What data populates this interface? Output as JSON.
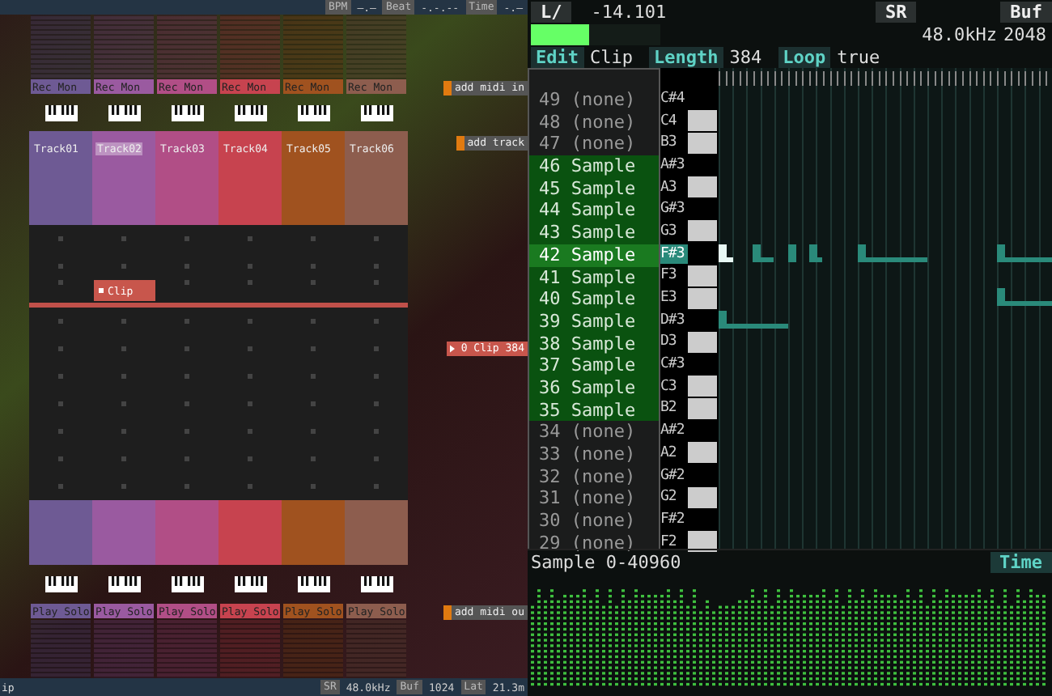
{
  "transport": [
    {
      "label": "BPM",
      "value": "—.—"
    },
    {
      "label": "Beat",
      "value": "-.-.--"
    },
    {
      "label": "Time",
      "value": "-.—"
    }
  ],
  "tracks": [
    {
      "name": "Track01",
      "color": "#6e5a94",
      "selected": false,
      "input": [
        "Rec",
        "Mon"
      ],
      "output": [
        "Play",
        "Solo"
      ]
    },
    {
      "name": "Track02",
      "color": "#9a5aa0",
      "selected": true,
      "input": [
        "Rec",
        "Mon"
      ],
      "output": [
        "Play",
        "Solo"
      ]
    },
    {
      "name": "Track03",
      "color": "#b14e86",
      "selected": false,
      "input": [
        "Rec",
        "Mon"
      ],
      "output": [
        "Play",
        "Solo"
      ]
    },
    {
      "name": "Track04",
      "color": "#c7434f",
      "selected": false,
      "input": [
        "Rec",
        "Mon"
      ],
      "output": [
        "Play",
        "Solo"
      ]
    },
    {
      "name": "Track05",
      "color": "#a0521f",
      "selected": false,
      "input": [
        "Rec",
        "Mon"
      ],
      "output": [
        "Play",
        "Solo"
      ]
    },
    {
      "name": "Track06",
      "color": "#8d5d4e",
      "selected": false,
      "input": [
        "Rec",
        "Mon"
      ],
      "output": [
        "Play",
        "Solo"
      ]
    }
  ],
  "add_midi_in": "add midi in",
  "add_track": "add track",
  "add_midi_out": "add midi ou",
  "scenes": [
    {
      "active": false
    },
    {
      "active": false
    },
    {
      "active": true,
      "slots": [
        {
          "kind": "empty"
        },
        {
          "kind": "clip",
          "label": "Clip",
          "color": "#c8564c"
        },
        {
          "kind": "empty"
        },
        {
          "kind": "empty"
        },
        {
          "kind": "empty"
        },
        {
          "kind": "empty"
        }
      ]
    },
    {
      "active": false
    },
    {
      "active": false,
      "launcher": "0 Clip 384"
    },
    {
      "active": false
    },
    {
      "active": false
    },
    {
      "active": false
    },
    {
      "active": false
    },
    {
      "active": false
    }
  ],
  "status_bar": {
    "left": "ip",
    "items": [
      {
        "label": "SR",
        "value": "48.0kHz"
      },
      {
        "label": "Buf",
        "value": "1024"
      },
      {
        "label": "Lat",
        "value": "21.3m"
      }
    ]
  },
  "editor": {
    "channel": "L/",
    "value": "-14.101",
    "level": 0.45,
    "sr": {
      "label": "SR",
      "value": "48.0kHz"
    },
    "buf": {
      "label": "Buf",
      "value": "2048"
    },
    "clip_bar": [
      {
        "label": "Edit",
        "value": "Clip"
      },
      {
        "label": "Length",
        "value": "384"
      },
      {
        "label": "Loop",
        "value": "true"
      }
    ],
    "keys": [
      {
        "number": "49",
        "name": "(none)",
        "note": "C#4",
        "kind": "black",
        "selected": false,
        "current": false
      },
      {
        "number": "48",
        "name": "(none)",
        "note": "C4",
        "kind": "white",
        "selected": false,
        "current": false
      },
      {
        "number": "47",
        "name": "(none)",
        "note": "B3",
        "kind": "white",
        "selected": false,
        "current": false
      },
      {
        "number": "46",
        "name": "Sample",
        "note": "A#3",
        "kind": "black",
        "selected": true,
        "current": false
      },
      {
        "number": "45",
        "name": "Sample",
        "note": "A3",
        "kind": "white",
        "selected": true,
        "current": false
      },
      {
        "number": "44",
        "name": "Sample",
        "note": "G#3",
        "kind": "black",
        "selected": true,
        "current": false
      },
      {
        "number": "43",
        "name": "Sample",
        "note": "G3",
        "kind": "white",
        "selected": true,
        "current": false
      },
      {
        "number": "42",
        "name": "Sample",
        "note": "F#3",
        "kind": "black",
        "selected": true,
        "current": true,
        "notes": [
          {
            "selected": true
          },
          {
            "selected": false
          },
          {
            "selected": false
          },
          {
            "selected": false
          },
          {
            "selected": false
          },
          {
            "selected": false
          }
        ]
      },
      {
        "number": "41",
        "name": "Sample",
        "note": "F3",
        "kind": "white",
        "selected": true,
        "current": false
      },
      {
        "number": "40",
        "name": "Sample",
        "note": "E3",
        "kind": "white",
        "selected": true,
        "current": false,
        "notes": [
          {
            "selected": false
          }
        ]
      },
      {
        "number": "39",
        "name": "Sample",
        "note": "D#3",
        "kind": "black",
        "selected": true,
        "current": false,
        "notes": [
          {
            "selected": false
          }
        ]
      },
      {
        "number": "38",
        "name": "Sample",
        "note": "D3",
        "kind": "white",
        "selected": true,
        "current": false
      },
      {
        "number": "37",
        "name": "Sample",
        "note": "C#3",
        "kind": "black",
        "selected": true,
        "current": false
      },
      {
        "number": "36",
        "name": "Sample",
        "note": "C3",
        "kind": "white",
        "selected": true,
        "current": false
      },
      {
        "number": "35",
        "name": "Sample",
        "note": "B2",
        "kind": "white",
        "selected": true,
        "current": false
      },
      {
        "number": "34",
        "name": "(none)",
        "note": "A#2",
        "kind": "black",
        "selected": false,
        "current": false
      },
      {
        "number": "33",
        "name": "(none)",
        "note": "A2",
        "kind": "white",
        "selected": false,
        "current": false
      },
      {
        "number": "32",
        "name": "(none)",
        "note": "G#2",
        "kind": "black",
        "selected": false,
        "current": false
      },
      {
        "number": "31",
        "name": "(none)",
        "note": "G2",
        "kind": "white",
        "selected": false,
        "current": false
      },
      {
        "number": "30",
        "name": "(none)",
        "note": "F#2",
        "kind": "black",
        "selected": false,
        "current": false
      },
      {
        "number": "29",
        "name": "(none)",
        "note": "F2",
        "kind": "white",
        "selected": false,
        "current": false
      }
    ],
    "sample_range": "Sample 0-40960",
    "time_tab": "Time"
  }
}
